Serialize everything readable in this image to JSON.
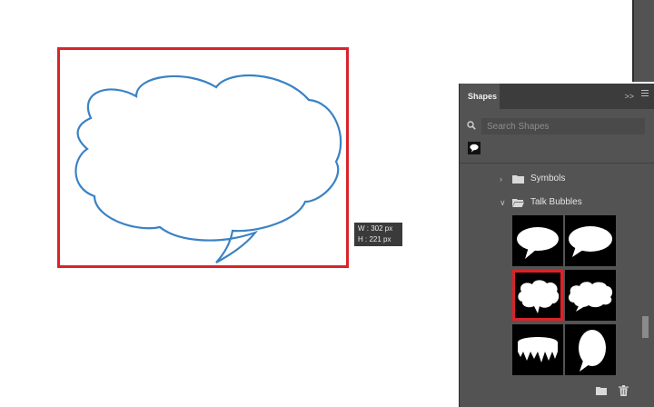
{
  "canvas": {
    "dimensions": {
      "width": "W : 302 px",
      "height": "H : 221 px"
    }
  },
  "panel": {
    "tab_label": "Shapes",
    "collapse_label": ">>",
    "search": {
      "placeholder": "Search Shapes",
      "value": ""
    },
    "groups": [
      {
        "label": "Symbols",
        "expanded": false
      },
      {
        "label": "Talk Bubbles",
        "expanded": true
      }
    ],
    "shapes": [
      {
        "icon": "oval-speech-bubble-icon"
      },
      {
        "icon": "wide-oval-speech-bubble-icon"
      },
      {
        "icon": "cloud-speech-bubble-icon",
        "selected": true
      },
      {
        "icon": "puffy-speech-bubble-icon"
      },
      {
        "icon": "dripping-speech-bubble-icon"
      },
      {
        "icon": "tall-oval-speech-bubble-icon"
      }
    ]
  },
  "colors": {
    "selection": "#d9232a",
    "shape_stroke": "#3b82c4",
    "panel_bg": "#535353",
    "panel_header": "#3c3c3c"
  }
}
